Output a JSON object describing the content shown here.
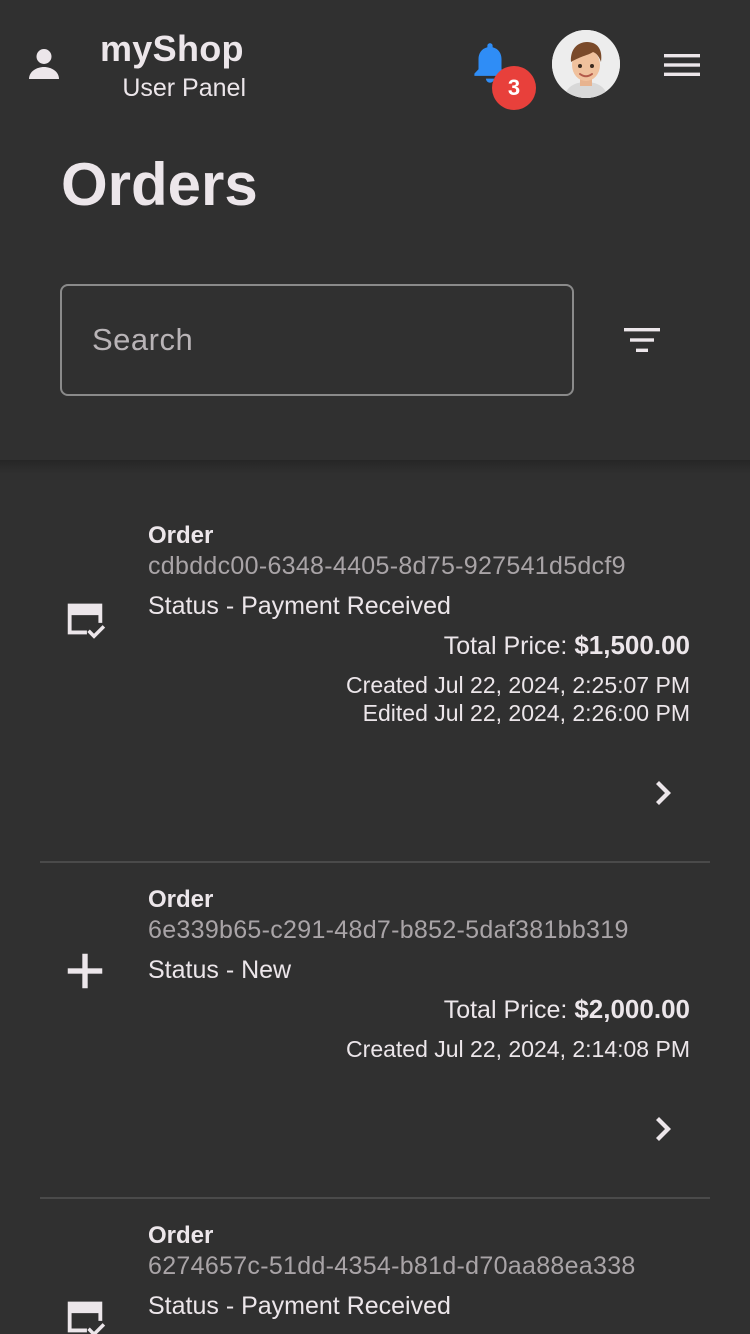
{
  "header": {
    "brand": "myShop",
    "subtitle": "User Panel",
    "notification_count": "3",
    "icons": [
      "account-icon",
      "bell-icon",
      "avatar",
      "menu-icon"
    ]
  },
  "page": {
    "title": "Orders"
  },
  "search": {
    "placeholder": "Search",
    "value": ""
  },
  "colors": {
    "background": "#303030",
    "bell": "#2f8df6",
    "badge": "#e8403b",
    "text": "#ece6ea",
    "muted": "#a9a4a7"
  },
  "orders": [
    {
      "label": "Order",
      "id": "cdbddc00-6348-4405-8d75-927541d5dcf9",
      "status": "Status - Payment Received",
      "price_label": "Total Price:",
      "price": "$1,500.00",
      "created": "Created Jul 22, 2024, 2:25:07 PM",
      "edited": "Edited Jul 22, 2024, 2:26:00 PM",
      "icon": "payment-check-icon"
    },
    {
      "label": "Order",
      "id": "6e339b65-c291-48d7-b852-5daf381bb319",
      "status": "Status - New",
      "price_label": "Total Price:",
      "price": "$2,000.00",
      "created": "Created Jul 22, 2024, 2:14:08 PM",
      "icon": "plus-icon"
    },
    {
      "label": "Order",
      "id": "6274657c-51dd-4354-b81d-d70aa88ea338",
      "status": "Status - Payment Received",
      "icon": "payment-check-icon"
    }
  ]
}
